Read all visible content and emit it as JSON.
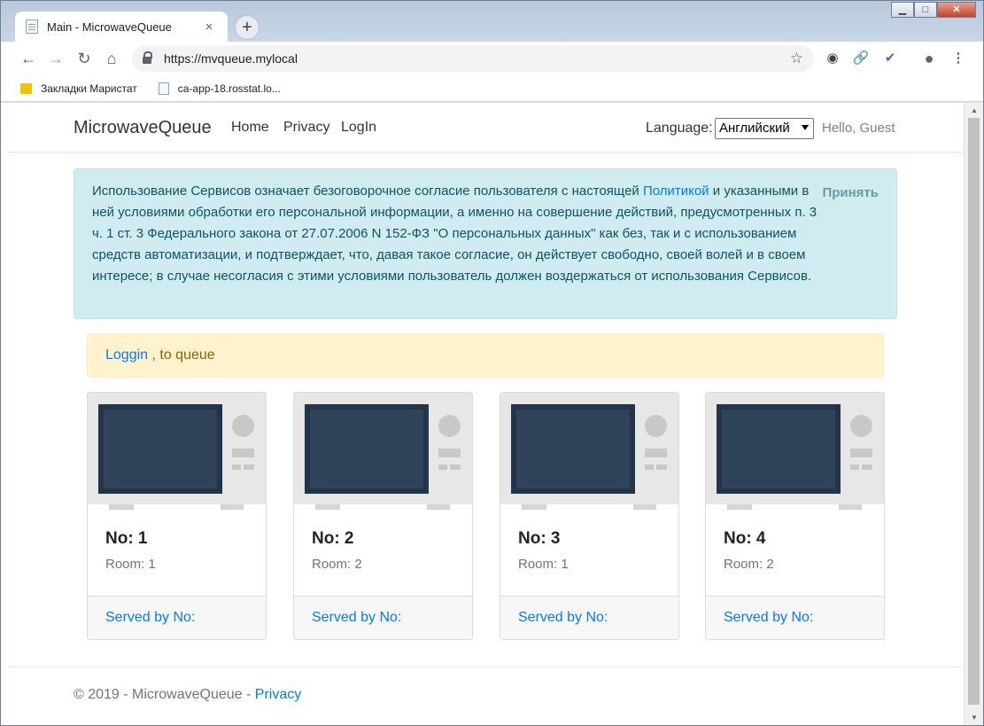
{
  "browser": {
    "tab_title": "Main - MicrowaveQueue",
    "tab_close": "×",
    "new_tab": "+",
    "url": "https://mvqueue.mylocal",
    "bookmarks": [
      "Закладки Маристат",
      "ca-app-18.rosstat.lo..."
    ]
  },
  "site": {
    "brand": "MicrowaveQueue",
    "nav": [
      "Home",
      "Privacy",
      "LogIn"
    ],
    "language_label": "Language:",
    "language_value": "Английский",
    "greeting": "Hello, Guest"
  },
  "consent": {
    "text_before_link": "Использование Сервисов означает безоговорочное согласие пользователя с настоящей ",
    "link_text": "Политикой",
    "text_after_link": " и указанными в ней условиями обработки его персональной информации, а именно на совершение действий, предусмотренных п. 3 ч. 1 ст. 3 Федерального закона от 27.07.2006 N 152-ФЗ \"О персональных данных\" как без, так и с использованием средств автоматизации, и подтверждает, что, давая такое согласие, он действует свободно, своей волей и в своем интересе; в случае несогласия с этими условиями пользователь должен воздержаться от использования Сервисов.",
    "accept_label": "Принять"
  },
  "login_alert": {
    "link_text": "Loggin",
    "text": " , to queue"
  },
  "microwaves": [
    {
      "title": "No: 1",
      "room": "Room: 1",
      "served": "Served by No:"
    },
    {
      "title": "No: 2",
      "room": "Room: 2",
      "served": "Served by No:"
    },
    {
      "title": "No: 3",
      "room": "Room: 1",
      "served": "Served by No:"
    },
    {
      "title": "No: 4",
      "room": "Room: 2",
      "served": "Served by No:"
    }
  ],
  "footer": {
    "copyright": "© 2019 - MicrowaveQueue - ",
    "privacy_link": "Privacy"
  }
}
